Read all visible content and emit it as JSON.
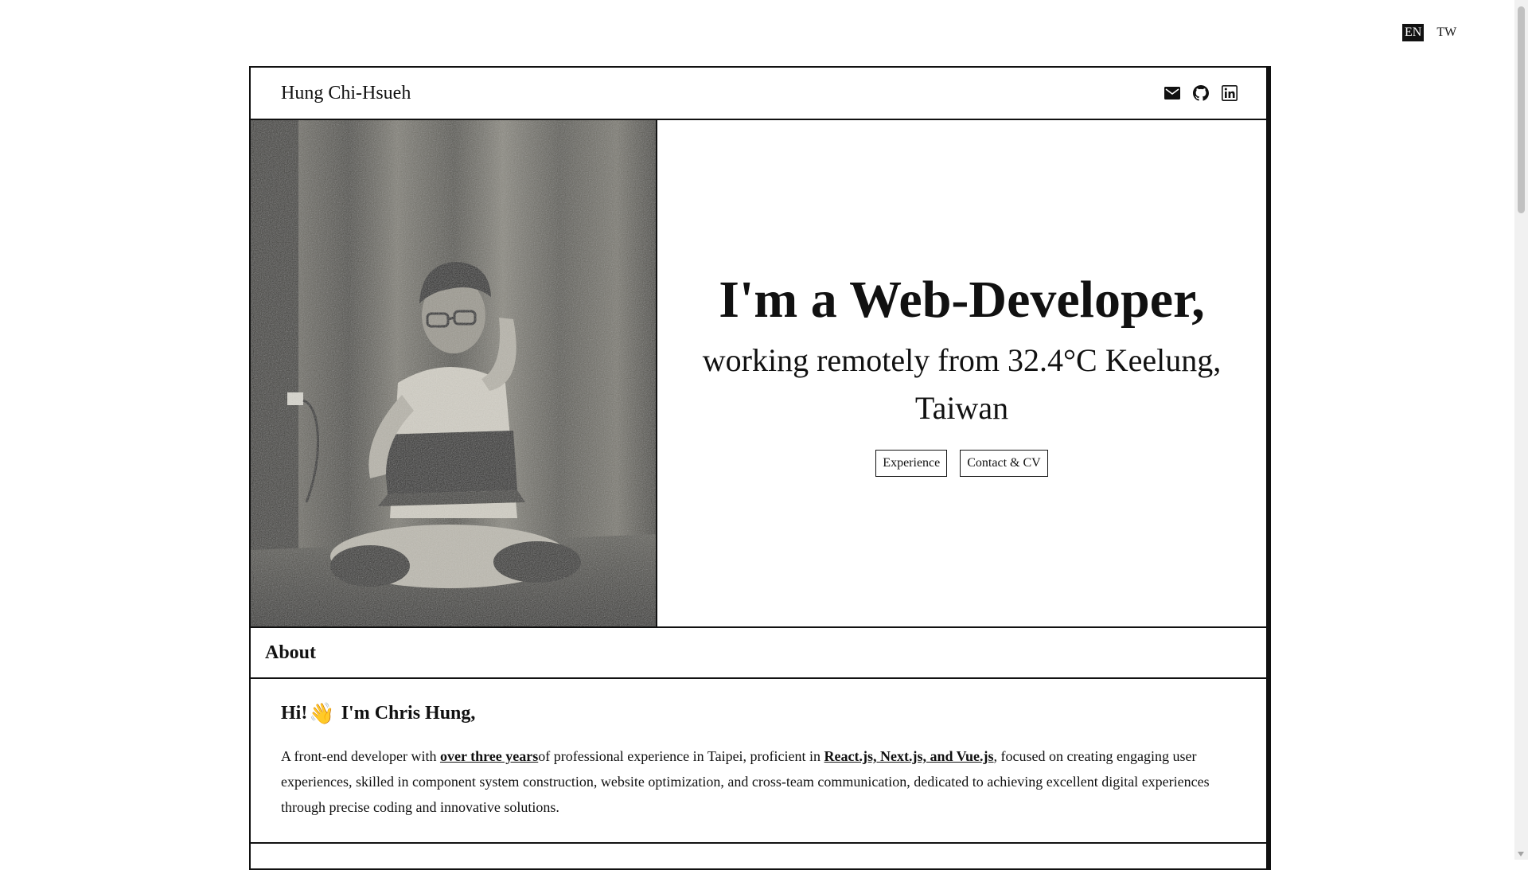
{
  "lang": {
    "en": "EN",
    "tw": "TW"
  },
  "header": {
    "brand": "Hung Chi-Hsueh",
    "social": [
      {
        "icon": "mail-icon"
      },
      {
        "icon": "github-icon"
      },
      {
        "icon": "linkedin-icon"
      }
    ]
  },
  "hero": {
    "title": "I'm a Web-Developer,",
    "subtitle": "working remotely from 32.4°C Keelung, Taiwan",
    "buttons": {
      "experience": "Experience",
      "contact": "Contact & CV"
    }
  },
  "about": {
    "heading": "About",
    "greeting_hi": "Hi!",
    "greeting_name": "I'm Chris Hung,",
    "wave": "👋",
    "text_1": "A front-end developer with ",
    "highlight_years": "over three years",
    "text_2": "of professional experience in Taipei, proficient in ",
    "highlight_stack": "React.js, Next.js, and Vue.js",
    "text_3": ", focused on creating engaging user experiences, skilled in component system construction, website optimization, and cross-team communication, dedicated to achieving excellent digital experiences through precise coding and innovative solutions."
  },
  "colors": {
    "ink": "#111111",
    "background": "#ffffff"
  }
}
